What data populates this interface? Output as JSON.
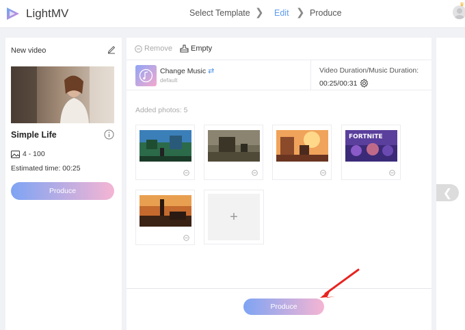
{
  "app": {
    "name": "LightMV"
  },
  "steps": [
    "Select Template",
    "Edit",
    "Produce"
  ],
  "left_panel": {
    "title": "New video",
    "template_name": "Simple Life",
    "photo_range": "4 - 100",
    "estimated_time": "Estimated time: 00:25",
    "produce_label": "Produce"
  },
  "toolbar": {
    "remove_label": "Remove",
    "empty_label": "Empty"
  },
  "music": {
    "title": "Change Music",
    "subtitle": "default",
    "duration_label": "Video Duration/Music Duration:",
    "duration_value": "00:25/00:31"
  },
  "photos": {
    "added_label": "Added photos: 5",
    "items": [
      "fortnite-battle",
      "pubg-scene",
      "cartoon-sunset",
      "fortnite-title",
      "car-sunset"
    ],
    "fortnite_text": "FORTNITE"
  },
  "footer": {
    "produce_label": "Produce"
  },
  "colors": {
    "accent": "#5b9bf0",
    "grad_start": "#7ea4f3",
    "grad_end": "#f5b5d3",
    "arrow": "#e8231e"
  }
}
